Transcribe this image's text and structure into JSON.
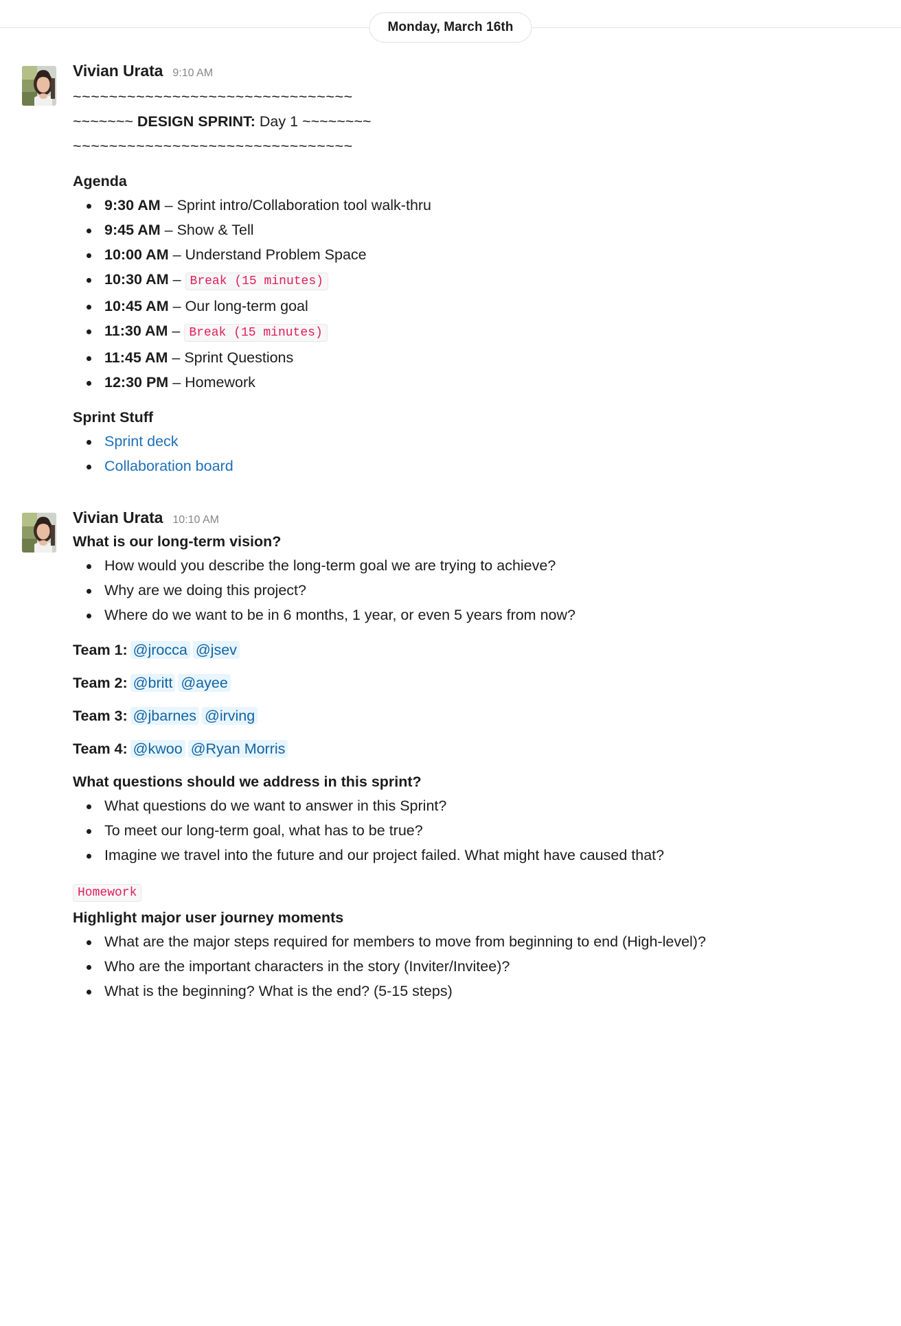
{
  "divider": {
    "label": "Monday, March 16th"
  },
  "messages": [
    {
      "author": "Vivian Urata",
      "time": "9:10 AM",
      "avatar_name": "avatar-vivian-urata",
      "tilde_top": "~~~~~~~~~~~~~~~~~~~~~~~~~~~~~~~",
      "banner_left": "~~~~~~~ ",
      "banner_bold": "DESIGN SPRINT:",
      "banner_rest": " Day 1 ~~~~~~~~",
      "tilde_bottom": "~~~~~~~~~~~~~~~~~~~~~~~~~~~~~~~",
      "agenda_heading": "Agenda",
      "agenda": [
        {
          "time": "9:30 AM",
          "dash": " – ",
          "text": "Sprint intro/Collaboration tool walk-thru",
          "code": ""
        },
        {
          "time": "9:45 AM",
          "dash": " – ",
          "text": "Show & Tell",
          "code": ""
        },
        {
          "time": "10:00 AM",
          "dash": " – ",
          "text": "Understand Problem Space",
          "code": ""
        },
        {
          "time": "10:30 AM",
          "dash": " – ",
          "text": "",
          "code": "Break (15 minutes)"
        },
        {
          "time": "10:45 AM",
          "dash": " – ",
          "text": "Our long-term goal",
          "code": ""
        },
        {
          "time": "11:30 AM",
          "dash": " – ",
          "text": "",
          "code": "Break (15 minutes)"
        },
        {
          "time": "11:45 AM",
          "dash": " – ",
          "text": "Sprint Questions",
          "code": ""
        },
        {
          "time": "12:30 PM",
          "dash": " – ",
          "text": "Homework",
          "code": ""
        }
      ],
      "sprint_stuff_heading": "Sprint Stuff",
      "sprint_links": [
        {
          "label": "Sprint deck"
        },
        {
          "label": "Collaboration board"
        }
      ]
    },
    {
      "author": "Vivian Urata",
      "time": "10:10 AM",
      "avatar_name": "avatar-vivian-urata",
      "vision_heading": "What is our long-term vision?",
      "vision_bullets": [
        "How would you describe the long-term goal we are trying to achieve?",
        "Why are we doing this project?",
        "Where do we want to be in 6 months, 1 year, or even 5 years from now?"
      ],
      "teams": [
        {
          "label": "Team 1:",
          "members": [
            "@jrocca",
            "@jsev"
          ]
        },
        {
          "label": "Team 2:",
          "members": [
            "@britt",
            "@ayee"
          ]
        },
        {
          "label": "Team 3:",
          "members": [
            "@jbarnes",
            "@irving"
          ]
        },
        {
          "label": "Team 4:",
          "members": [
            "@kwoo",
            "@Ryan Morris"
          ]
        }
      ],
      "questions_heading": "What questions should we address in this sprint?",
      "questions_bullets": [
        "What questions do we want to answer in this Sprint?",
        "To meet our long-term goal, what has to be true?",
        "Imagine we travel into the future and our project failed. What might have caused that?"
      ],
      "homework_badge": "Homework",
      "homework_heading": "Highlight major user journey moments",
      "homework_bullets": [
        "What are the major steps required for members to move from beginning to end (High-level)?",
        "Who are the important characters in the story (Inviter/Invitee)?",
        "What is the beginning? What is the end? (5-15 steps)"
      ]
    }
  ],
  "colors": {
    "code_text": "#e01e5a",
    "code_bg": "#f7f7f7",
    "link": "#1d6fb8",
    "mention_text": "#1264a3",
    "mention_bg": "#e8f5fd",
    "text": "#1d1c1d",
    "timestamp": "#868686"
  }
}
